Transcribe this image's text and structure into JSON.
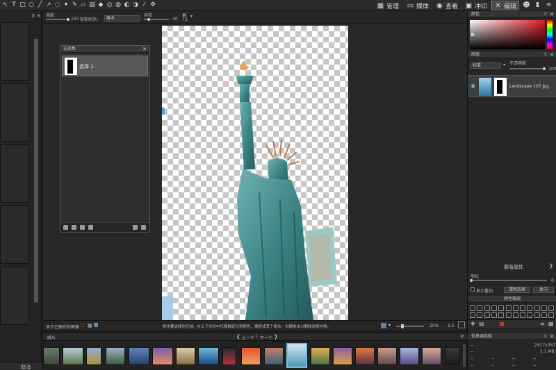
{
  "toolbar": {
    "tools": [
      "cursor-icon",
      "text-icon",
      "rect-icon",
      "ellipse-icon",
      "line-icon",
      "arrow-icon",
      "lasso-icon",
      "magic-wand-icon",
      "brush-icon",
      "eraser-icon",
      "gradient-icon",
      "bucket-icon",
      "clone-icon",
      "blur-icon",
      "dodge-icon",
      "burn-icon",
      "eyedropper-icon",
      "move-icon"
    ],
    "modes": [
      {
        "label": "管理",
        "icon": "grid-icon"
      },
      {
        "label": "媒体",
        "icon": "folder-icon"
      },
      {
        "label": "查看",
        "icon": "eye-icon"
      },
      {
        "label": "冲印",
        "icon": "develop-icon"
      },
      {
        "label": "编辑",
        "icon": "edit-icon"
      }
    ],
    "extra_icons": [
      "face-icon",
      "stats-icon",
      "menu-icon"
    ]
  },
  "options": {
    "hardness_label": "强度",
    "hardness_value": "100",
    "smart_brush_label": "智能刷涂：",
    "smart_brush_value": "魔术",
    "size_label": "容差",
    "size_value": "30",
    "second_value_label": "偏",
    "second_value": "73"
  },
  "selection_panel": {
    "title": "选择集",
    "item_label": "选择 1"
  },
  "status": {
    "left_text": "显示已保存的图像",
    "center_text": "刷涂要选择的区域。在上下文栏中托笔触定位到那色，离度或其个组合：右键单击以删除选择内容。",
    "zoom": "20%",
    "ratio": "1:1"
  },
  "filmstrip": {
    "tab": "照片",
    "prev": "上一个",
    "next": "下一个"
  },
  "right": {
    "color_title": "颜色",
    "layers_title": "图层",
    "blend_mode": "标准",
    "opacity_label": "不透明度",
    "opacity_value": "100",
    "layer_name": "Landscape 107.jpg",
    "properties_title": "要版属性",
    "feather_label": "羽化",
    "feather_value": "0",
    "show_overlay": "显示叠加",
    "clear_button": "清除选择",
    "invert_button": "反向",
    "adjust_title": "颜色微调",
    "info_title": "信息调色板",
    "info_dims": "2917x3672",
    "info_size": "1.1 MB",
    "info_placeholder": "--"
  },
  "bottom_left": {
    "cancel": "取消"
  },
  "colors": {
    "accent": "#4a90c8",
    "panel": "#262626"
  }
}
